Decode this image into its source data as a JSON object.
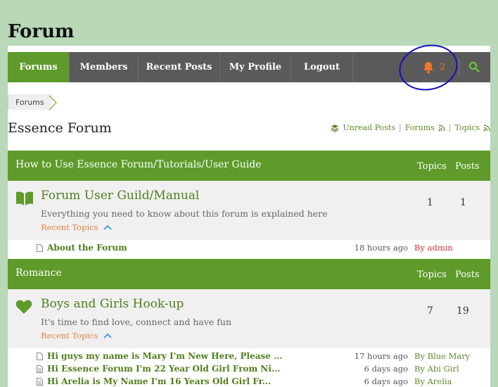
{
  "page": {
    "title": "Forum"
  },
  "nav": {
    "items": [
      {
        "label": "Forums",
        "active": true
      },
      {
        "label": "Members",
        "active": false
      },
      {
        "label": "Recent Posts",
        "active": false
      },
      {
        "label": "My Profile",
        "active": false
      },
      {
        "label": "Logout",
        "active": false
      }
    ],
    "notification_count": "2",
    "bell_icon": "bell-icon",
    "search_icon": "search-icon"
  },
  "breadcrumb": {
    "label": "Forums"
  },
  "forum_header": {
    "name": "Essence Forum",
    "links": {
      "unread": "Unread Posts",
      "forums": "Forums",
      "topics": "Topics",
      "separator": "|"
    }
  },
  "categories": [
    {
      "title": "How to Use Essence Forum/Tutorials/User Guide",
      "col_topics": "Topics",
      "col_posts": "Posts",
      "forum": {
        "title": "Forum User Guild/Manual",
        "description": "Everything you need to know about this forum is explained here",
        "recent_label": "Recent Topics",
        "topics": "1",
        "posts": "1",
        "icon": "book-icon"
      },
      "recent": [
        {
          "title": "About the Forum",
          "time": "18 hours ago",
          "by": "By admin",
          "by_color": "#d9342b"
        }
      ]
    },
    {
      "title": "Romance",
      "col_topics": "Topics",
      "col_posts": "Posts",
      "forum": {
        "title": "Boys and Girls Hook-up",
        "description": "It's time to find love, connect and have fun",
        "recent_label": "Recent Topics",
        "topics": "7",
        "posts": "19",
        "icon": "heart-icon"
      },
      "recent": [
        {
          "title": "Hi guys my name is Mary I'm New Here, Please ...",
          "time": "17 hours ago",
          "by": "By Blue Mary",
          "by_color": "#5a8a2a"
        },
        {
          "title": "Hi Essence Forum I'm 22 Year Old Girl From Ni...",
          "time": "6 days ago",
          "by": "By Abi Girl",
          "by_color": "#5a8a2a"
        },
        {
          "title": "Hi Arelia is My Name I'm 16 Years Old Girl Fr...",
          "time": "6 days ago",
          "by": "By Arelia",
          "by_color": "#5a8a2a"
        }
      ]
    }
  ],
  "colors": {
    "green": "#5e9b2a",
    "nav_bg": "#5a5a5a",
    "accent_orange": "#f0772b",
    "annotation": "#1010c0"
  }
}
